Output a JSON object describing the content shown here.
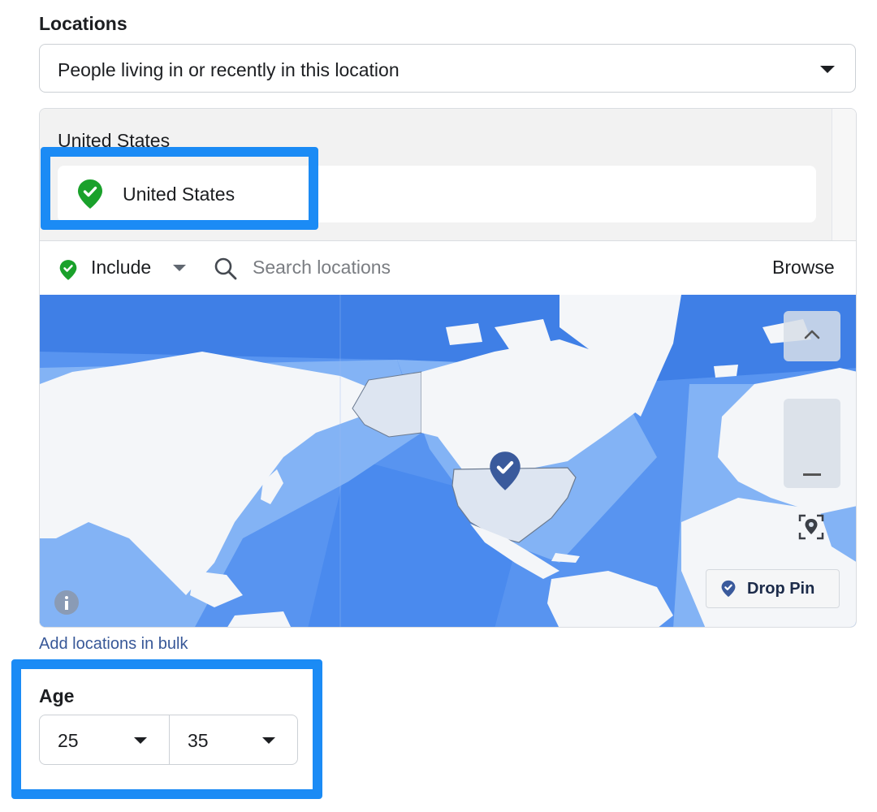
{
  "locations": {
    "title": "Locations",
    "audience_type": "People living in or recently in this location",
    "selected_group": "United States",
    "selected_items": [
      {
        "label": "United States",
        "icon": "green-check-pin-icon"
      }
    ],
    "include_mode": "Include",
    "search_placeholder": "Search locations",
    "browse_label": "Browse",
    "drop_pin_label": "Drop Pin",
    "bulk_link": "Add locations in bulk"
  },
  "age": {
    "title": "Age",
    "min": "25",
    "max": "35"
  },
  "colors": {
    "highlight": "#1b8bf5",
    "include_green": "#1aa12b",
    "ocean": "#4f8fee",
    "pin_navy": "#3a5a9c",
    "link": "#385898"
  },
  "icons": {
    "dropdown": "caret-down-icon",
    "search": "search-icon",
    "map_info": "info-icon",
    "map_zoom_in": "chevron-up-icon",
    "map_zoom_out": "minus-icon",
    "map_locate": "locate-icon",
    "map_pin": "check-pin-icon"
  }
}
